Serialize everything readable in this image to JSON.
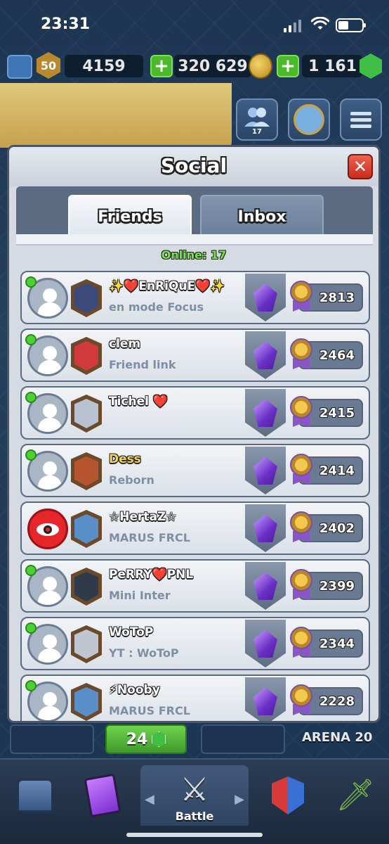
{
  "status_bar": {
    "time": "23:31"
  },
  "resources": {
    "level": "50",
    "trophies": "4159",
    "gold": "320 629",
    "gems": "1 161"
  },
  "header": {
    "friends_count": "17"
  },
  "modal": {
    "title": "Social",
    "close_label": "✕",
    "tabs": [
      {
        "label": "Friends",
        "active": true
      },
      {
        "label": "Inbox",
        "active": false
      }
    ],
    "online_label": "Online: 17"
  },
  "friends": [
    {
      "name": "✨❤️EnRiQuE❤️✨",
      "status": "en mode Focus",
      "trophies": "2813",
      "online": true,
      "clan_color": "#3b4a7a"
    },
    {
      "name": "clem",
      "status": "Friend link",
      "trophies": "2464",
      "online": true,
      "clan_color": "#d03a3a"
    },
    {
      "name": "Tichel ❤️",
      "status": "",
      "trophies": "2415",
      "online": true,
      "clan_color": "#b8c2d0"
    },
    {
      "name": "Dess",
      "status": "Reborn",
      "trophies": "2414",
      "online": true,
      "clan_color": "#b5542f",
      "gold_name": true
    },
    {
      "name": "☆HertaZ☆",
      "status": "MARUS FRCL",
      "trophies": "2402",
      "online": false,
      "clan_color": "#5a8ec8",
      "red_avatar": true
    },
    {
      "name": "PeRRY❤️PNL",
      "status": "Mini Inter",
      "trophies": "2399",
      "online": true,
      "clan_color": "#2f3a4a"
    },
    {
      "name": "WoToP",
      "status": "YT : WoToP",
      "trophies": "2344",
      "online": true,
      "clan_color": "#c0c6cf"
    },
    {
      "name": "⚡Nooby",
      "status": "MARUS FRCL",
      "trophies": "2228",
      "online": true,
      "clan_color": "#5a8ec8"
    }
  ],
  "below": {
    "gem_cost": "24",
    "arena_label": "ARENA 20"
  },
  "navbar": {
    "battle_label": "Battle"
  }
}
